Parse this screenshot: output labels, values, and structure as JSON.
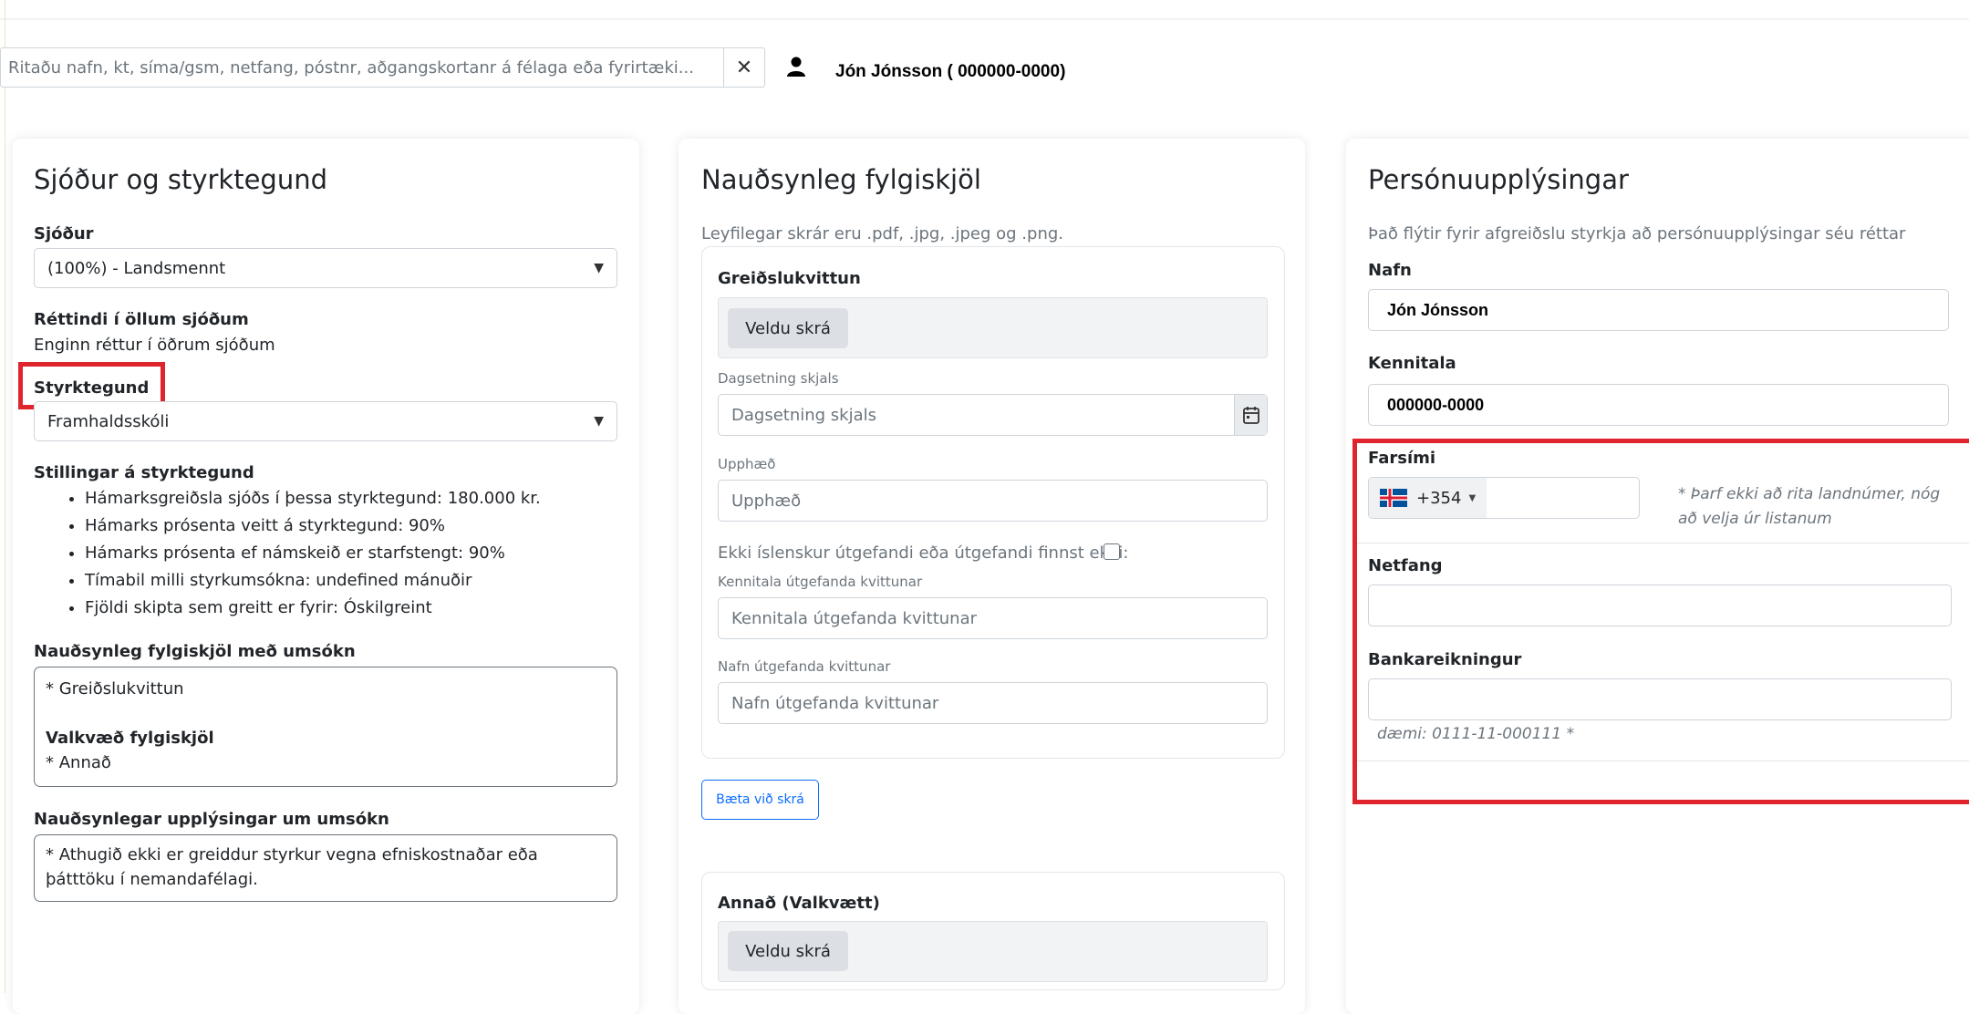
{
  "search": {
    "placeholder": "Ritaðu nafn, kt, síma/gsm, netfang, póstnr, aðgangskortanr á félaga eða fyrirtæki...",
    "clear_icon": "close-icon"
  },
  "user": {
    "name": "Jón Jónsson ( 000000-0000)",
    "icon": "user-icon"
  },
  "left_card": {
    "title": "Sjóður og styrktegund",
    "fund_label": "Sjóður",
    "fund_value": "(100%) - Landsmennt",
    "rights_label": "Réttindi í öllum sjóðum",
    "rights_value": "Enginn réttur í öðrum sjóðum",
    "grant_type_label": "Styrktegund",
    "grant_type_value": "Framhaldsskóli",
    "settings_label": "Stillingar á styrktegund",
    "settings_items": [
      "Hámarksgreiðsla sjóðs í þessa styrktegund: 180.000 kr.",
      "Hámarks prósenta veitt á styrktegund: 90%",
      "Hámarks prósenta ef námskeið er starfstengt: 90%",
      "Tímabil milli styrkumsókna: undefined mánuðir",
      "Fjöldi skipta sem greitt er fyrir: Óskilgreint"
    ],
    "required_docs_label": "Nauðsynleg fylgiskjöl með umsókn",
    "required_docs_item": "* Greiðslukvittun",
    "optional_docs_label": "Valkvæð fylgiskjöl",
    "optional_docs_item": "* Annað",
    "required_info_label": "Nauðsynlegar upplýsingar um umsókn",
    "required_info_text": "* Athugið ekki er greiddur styrkur vegna efniskostnaðar eða þátttöku í nemandafélagi."
  },
  "middle_card": {
    "title": "Nauðsynleg fylgiskjöl",
    "allowed_files": "Leyfilegar skrár eru .pdf, .jpg, .jpeg og .png.",
    "receipt_title": "Greiðslukvittun",
    "choose_file": "Veldu skrá",
    "date_label": "Dagsetning skjals",
    "date_placeholder": "Dagsetning skjals",
    "amount_label": "Upphæð",
    "amount_placeholder": "Upphæð",
    "not_icelandic_label": "Ekki íslenskur útgefandi eða útgefandi finnst ekki:",
    "issuer_id_label": "Kennitala útgefanda kvittunar",
    "issuer_id_placeholder": "Kennitala útgefanda kvittunar",
    "issuer_name_label": "Nafn útgefanda kvittunar",
    "issuer_name_placeholder": "Nafn útgefanda kvittunar",
    "add_file": "Bæta við skrá",
    "other_title": "Annað (Valkvætt)",
    "other_choose_file": "Veldu skrá"
  },
  "right_card": {
    "title": "Persónuupplýsingar",
    "subtitle": "Það flýtir fyrir afgreiðslu styrkja að persónuupplýsingar séu réttar",
    "name_label": "Nafn",
    "name_value": "Jón Jónsson",
    "ssn_label": "Kennitala",
    "ssn_value": "000000-0000",
    "phone_label": "Farsími",
    "phone_code": "+354",
    "phone_flag": "iceland-flag-icon",
    "phone_note": "* Þarf ekki að rita landnúmer, nóg að velja úr listanum",
    "email_label": "Netfang",
    "bank_label": "Bankareikningur",
    "bank_example": "dæmi: 0111-11-000111 *"
  },
  "colors": {
    "highlight": "#e0242e",
    "primary": "#0d6efd"
  }
}
